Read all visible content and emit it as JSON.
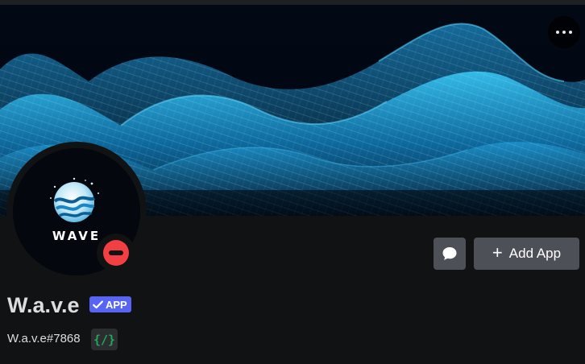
{
  "profile": {
    "display_name": "W.a.v.e",
    "username": "W.a.v.e#7868",
    "bot_tag": "APP",
    "avatar_text": "WAVE",
    "status": "do-not-disturb",
    "slash_commands_badge": "{/}"
  },
  "actions": {
    "add_app_label": "Add App",
    "more_icon": "more-horizontal-icon",
    "message_icon": "chat-bubble-icon"
  },
  "colors": {
    "background": "#111214",
    "button": "#4e5058",
    "badge": "#5865f2",
    "status_dnd": "#f23f43",
    "slash_green": "#23a55a",
    "banner_accent": "#1fb4e8"
  }
}
